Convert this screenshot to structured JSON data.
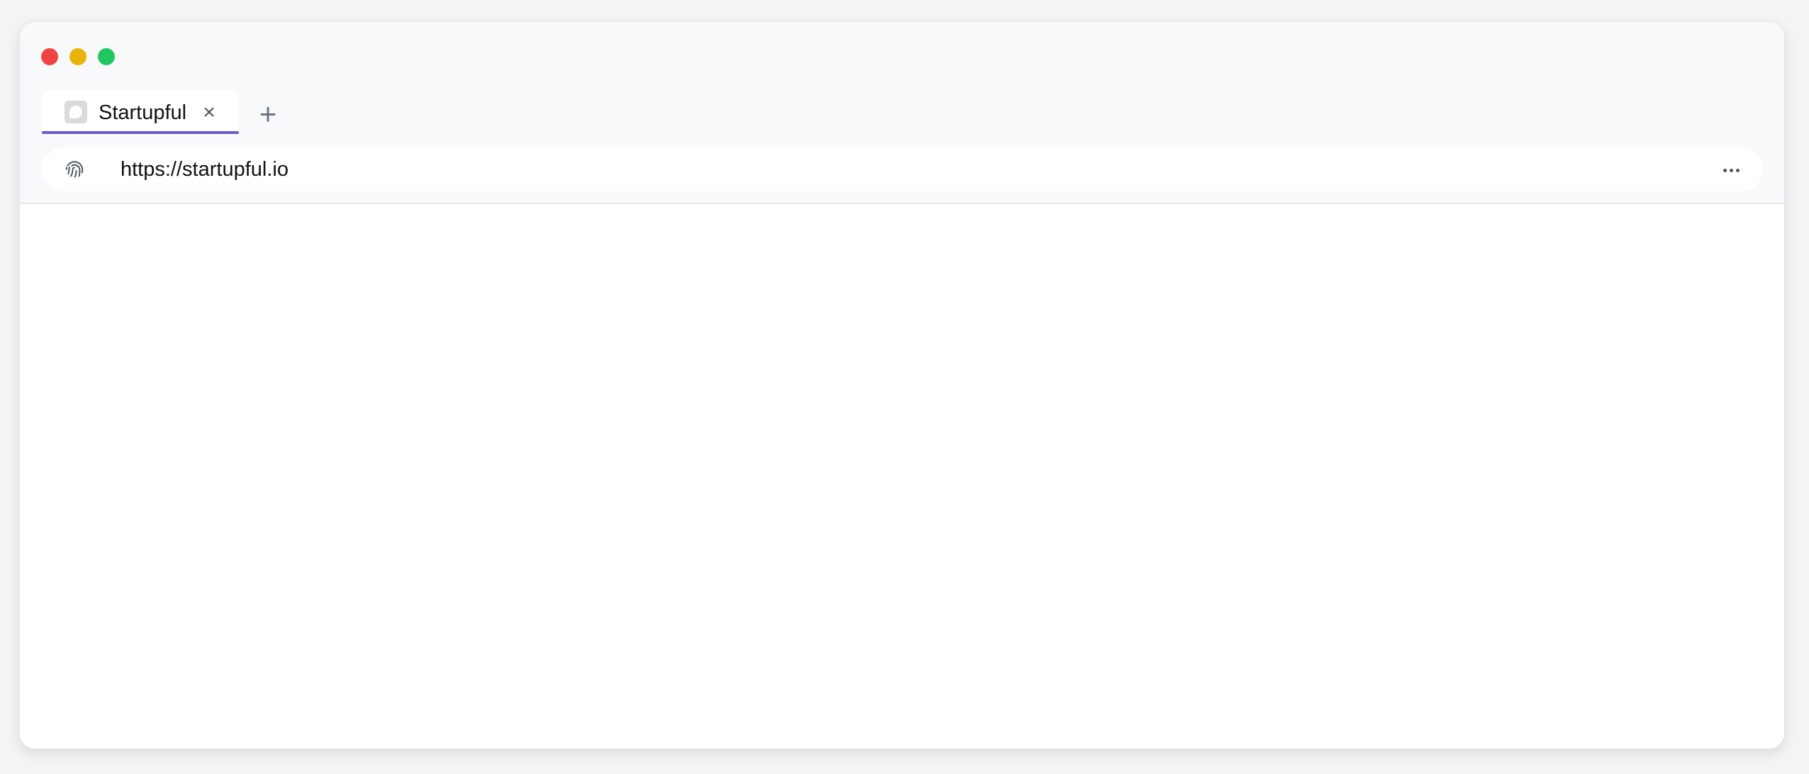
{
  "window": {
    "controls": [
      "close",
      "minimize",
      "zoom"
    ]
  },
  "tabs": [
    {
      "title": "Startupful",
      "active": true,
      "icon": "startupful-favicon"
    }
  ],
  "new_tab_symbol": "+",
  "tab_close_symbol": "×",
  "address_bar": {
    "url": "https://startupful.io",
    "security_icon": "fingerprint-icon",
    "menu_icon": "more-horizontal-icon"
  },
  "colors": {
    "accent": "#6d5bd0",
    "close": "#ef4444",
    "minimize": "#eab308",
    "zoom": "#22c55e"
  }
}
